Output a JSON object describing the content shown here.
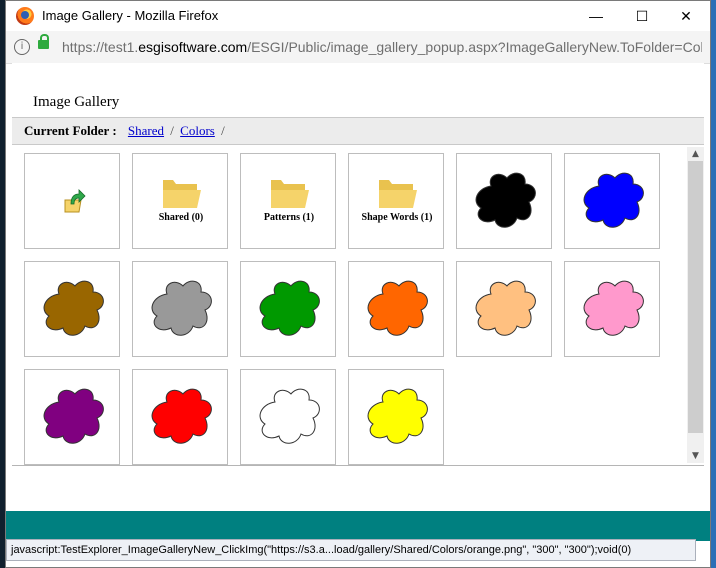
{
  "window": {
    "title": "Image Gallery - Mozilla Firefox",
    "minimize_glyph": "—",
    "maximize_glyph": "☐",
    "close_glyph": "✕"
  },
  "urlbar": {
    "info_glyph": "i",
    "url_prefix": "https://test1.",
    "url_domain": "esgisoftware.com",
    "url_suffix": "/ESGI/Public/image_gallery_popup.aspx?ImageGalleryNew.ToFolder=Colors"
  },
  "page": {
    "title": "Image Gallery",
    "current_folder_label": "Current Folder :",
    "breadcrumb": [
      {
        "label": "Shared"
      },
      {
        "label": "Colors"
      }
    ],
    "separator": "/"
  },
  "tiles": [
    {
      "kind": "up",
      "icon": "folder-up-icon"
    },
    {
      "kind": "folder",
      "label": "Shared (0)",
      "icon": "folder-icon"
    },
    {
      "kind": "folder",
      "label": "Patterns (1)",
      "icon": "folder-icon"
    },
    {
      "kind": "folder",
      "label": "Shape Words (1)",
      "icon": "folder-icon"
    },
    {
      "kind": "blob",
      "color": "#000000",
      "name": "black"
    },
    {
      "kind": "blob",
      "color": "#0000ff",
      "name": "blue"
    },
    {
      "kind": "blob",
      "color": "#996600",
      "name": "brown"
    },
    {
      "kind": "blob",
      "color": "#999999",
      "name": "gray"
    },
    {
      "kind": "blob",
      "color": "#009900",
      "name": "green"
    },
    {
      "kind": "blob",
      "color": "#ff6600",
      "name": "orange"
    },
    {
      "kind": "blob",
      "color": "#ffc080",
      "name": "peach"
    },
    {
      "kind": "blob",
      "color": "#ff99cc",
      "name": "pink"
    },
    {
      "kind": "blob",
      "color": "#800080",
      "name": "purple"
    },
    {
      "kind": "blob",
      "color": "#ff0000",
      "name": "red"
    },
    {
      "kind": "blob",
      "color": "#ffffff",
      "name": "white"
    },
    {
      "kind": "blob",
      "color": "#ffff00",
      "name": "yellow"
    }
  ],
  "scroll": {
    "up_glyph": "▲",
    "down_glyph": "▼"
  },
  "status": {
    "text": "javascript:TestExplorer_ImageGalleryNew_ClickImg(\"https://s3.a...load/gallery/Shared/Colors/orange.png\", \"300\", \"300\");void(0)"
  },
  "colors": {
    "teal": "#008080",
    "folder": "#f5d36a",
    "link": "#0000cc"
  }
}
